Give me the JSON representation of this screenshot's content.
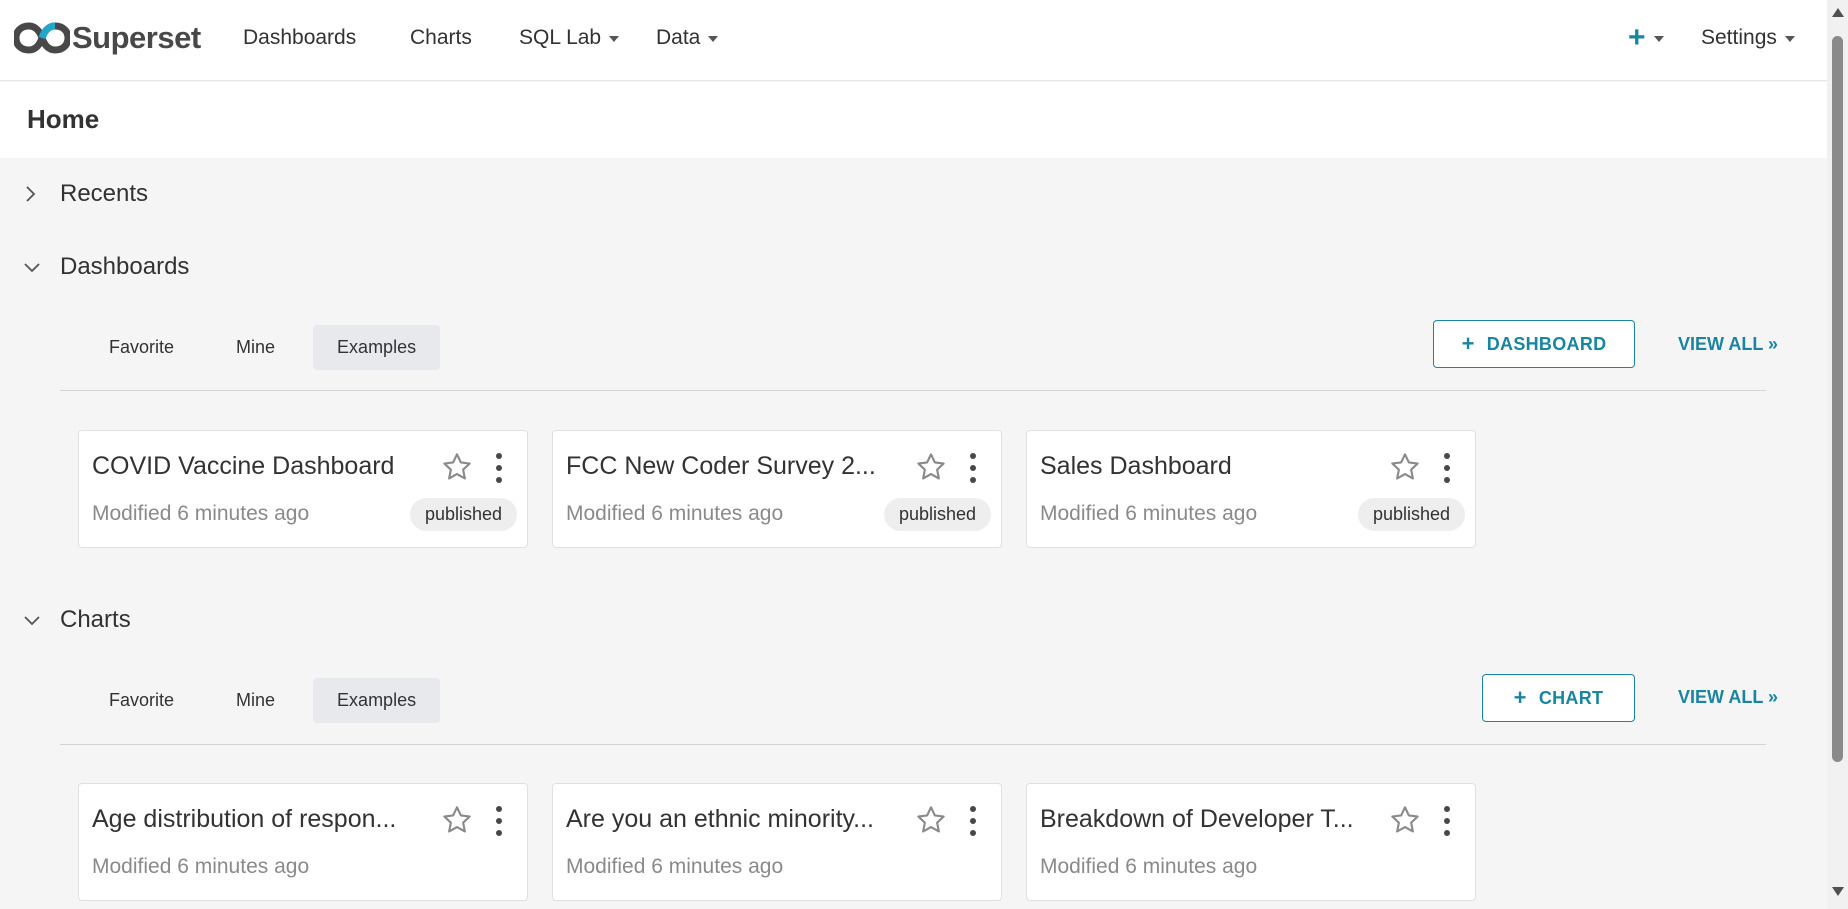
{
  "brand": {
    "name": "Superset",
    "logo_icon": "superset-infinity-logo",
    "accent_color": "#1a85a0"
  },
  "nav": {
    "dashboards": "Dashboards",
    "charts": "Charts",
    "sql_lab": "SQL Lab",
    "data": "Data",
    "settings": "Settings",
    "plus_icon": "plus-icon"
  },
  "page": {
    "title": "Home"
  },
  "sections": {
    "recents": {
      "title": "Recents",
      "expanded": false
    },
    "dashboards": {
      "title": "Dashboards",
      "expanded": true,
      "tabs": [
        "Favorite",
        "Mine",
        "Examples"
      ],
      "active_tab": "Examples",
      "add_label": "DASHBOARD",
      "view_all": "VIEW ALL »",
      "cards": [
        {
          "title": "COVID Vaccine Dashboard",
          "modified": "Modified 6 minutes ago",
          "badge": "published"
        },
        {
          "title": "FCC New Coder Survey 2...",
          "modified": "Modified 6 minutes ago",
          "badge": "published"
        },
        {
          "title": "Sales Dashboard",
          "modified": "Modified 6 minutes ago",
          "badge": "published"
        }
      ]
    },
    "charts": {
      "title": "Charts",
      "expanded": true,
      "tabs": [
        "Favorite",
        "Mine",
        "Examples"
      ],
      "active_tab": "Examples",
      "add_label": "CHART",
      "view_all": "VIEW ALL »",
      "cards": [
        {
          "title": "Age distribution of respon...",
          "modified": "Modified 6 minutes ago"
        },
        {
          "title": "Are you an ethnic minority...",
          "modified": "Modified 6 minutes ago"
        },
        {
          "title": "Breakdown of Developer T...",
          "modified": "Modified 6 minutes ago"
        }
      ]
    }
  }
}
